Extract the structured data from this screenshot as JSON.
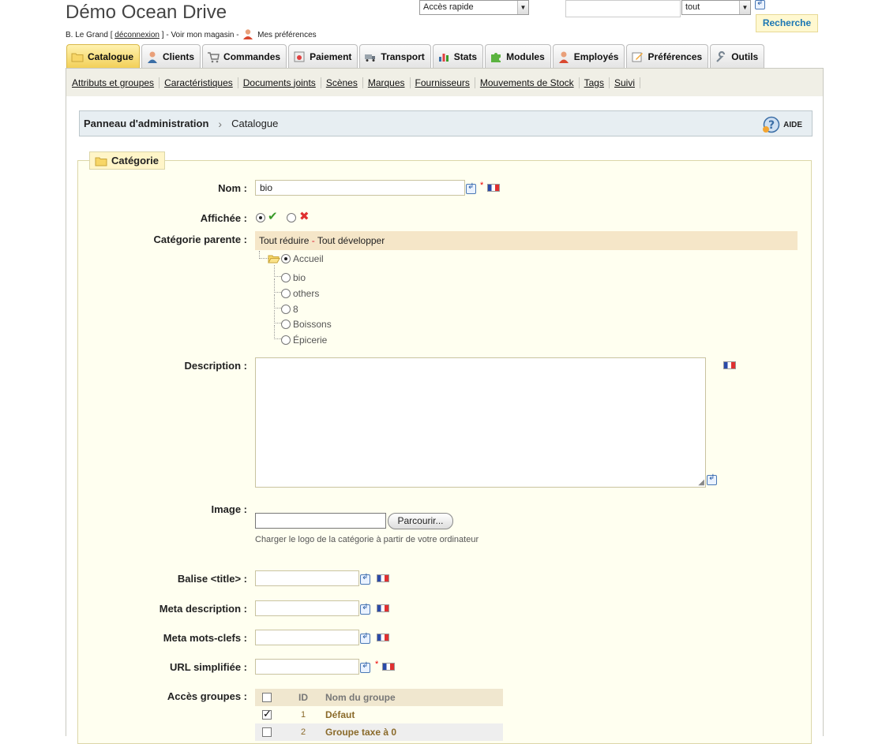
{
  "header": {
    "shop_title": "Démo Ocean Drive",
    "user_name": "B. Le Grand",
    "logout_label": "déconnexion",
    "view_store_label": "Voir mon magasin",
    "preferences_label": "Mes préférences",
    "quick_access": "Accès rapide",
    "search_value": "",
    "search_scope": "tout",
    "search_button": "Recherche"
  },
  "tabs": [
    {
      "label": "Catalogue",
      "icon": "folder-icon",
      "active": true
    },
    {
      "label": "Clients",
      "icon": "user-icon"
    },
    {
      "label": "Commandes",
      "icon": "cart-icon"
    },
    {
      "label": "Paiement",
      "icon": "payment-icon"
    },
    {
      "label": "Transport",
      "icon": "truck-icon"
    },
    {
      "label": "Stats",
      "icon": "chart-icon"
    },
    {
      "label": "Modules",
      "icon": "puzzle-icon"
    },
    {
      "label": "Employés",
      "icon": "employee-icon"
    },
    {
      "label": "Préférences",
      "icon": "edit-icon"
    },
    {
      "label": "Outils",
      "icon": "wrench-icon"
    }
  ],
  "subnav": [
    "Attributs et groupes",
    "Caractéristiques",
    "Documents joints",
    "Scènes",
    "Marques",
    "Fournisseurs",
    "Mouvements de Stock",
    "Tags",
    "Suivi"
  ],
  "breadcrumb": {
    "root": "Panneau d'administration",
    "current": "Catalogue",
    "help": "AIDE"
  },
  "form": {
    "legend": "Catégorie",
    "name_label": "Nom :",
    "name_value": "bio",
    "displayed_label": "Affichée :",
    "parent_label": "Catégorie parente :",
    "collapse_all": "Tout réduire",
    "tree_separator": " - ",
    "expand_all": "Tout développer",
    "tree": {
      "root": "Accueil",
      "children": [
        "bio",
        "others",
        "8",
        "Boissons",
        "Épicerie"
      ]
    },
    "description_label": "Description :",
    "image_label": "Image :",
    "browse_button": "Parcourir...",
    "image_hint": "Charger le logo de la catégorie à partir de votre ordinateur",
    "meta_title_label": "Balise <title> :",
    "meta_description_label": "Meta description :",
    "meta_keywords_label": "Meta mots-clefs :",
    "friendly_url_label": "URL simplifiée :",
    "groups_label": "Accès groupes :",
    "groups_table": {
      "headers": [
        "ID",
        "Nom du groupe"
      ],
      "rows": [
        {
          "id": "1",
          "name": "Défaut",
          "checked": true
        },
        {
          "id": "2",
          "name": "Groupe taxe à 0",
          "checked": false
        }
      ]
    }
  },
  "colors": {
    "accent_tab": "#f2cf55",
    "link_blue": "#1b76b4",
    "fieldset_bg": "#fffff0"
  }
}
